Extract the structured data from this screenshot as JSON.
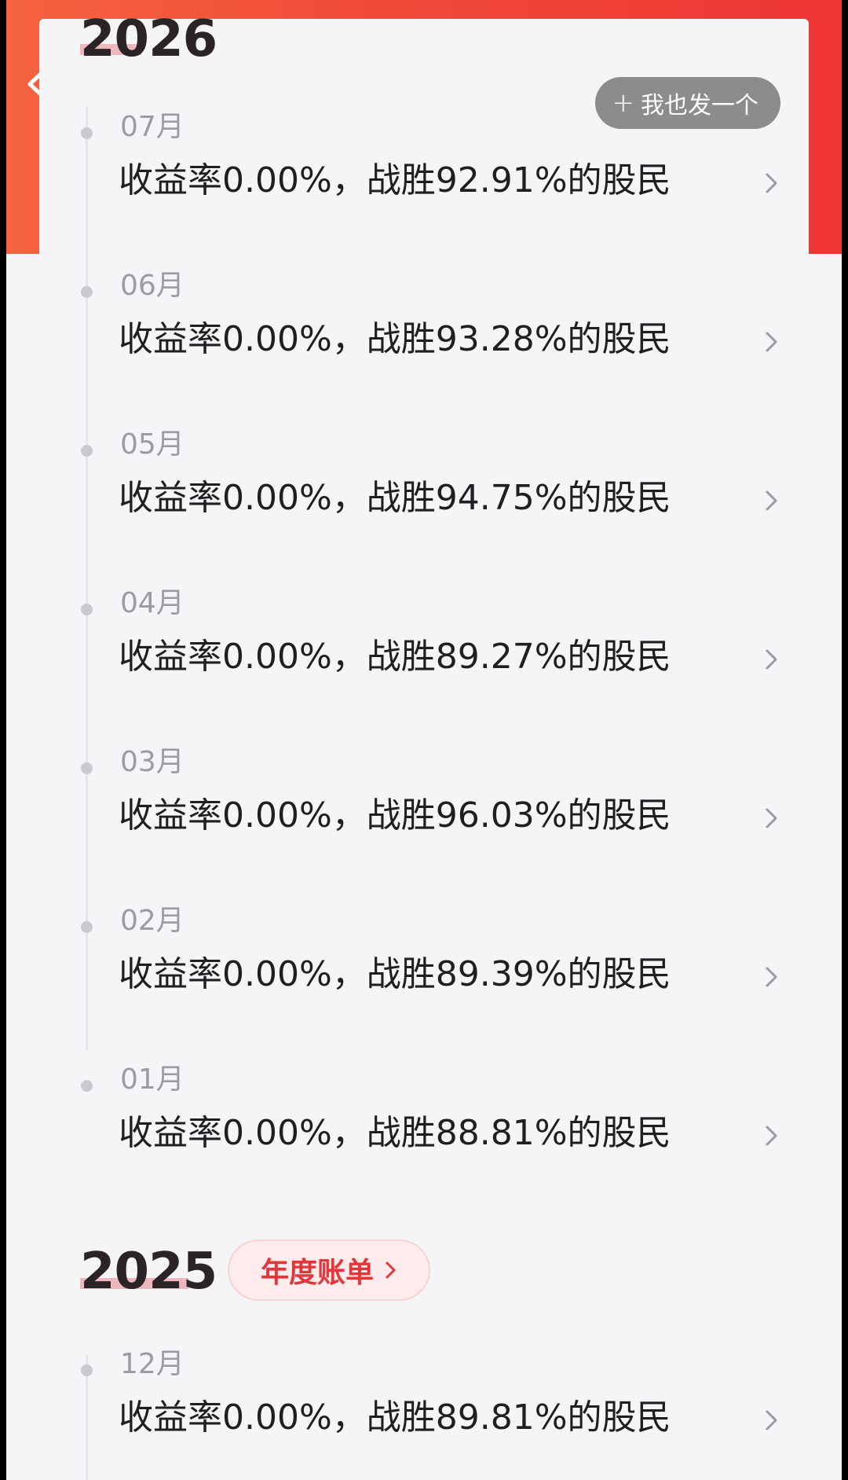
{
  "header": {
    "back_icon": "chevron-left-icon",
    "post_button": {
      "icon": "plus-icon",
      "label": "我也发一个"
    },
    "accent_color": "#ee3a3a"
  },
  "years": [
    {
      "year": "2026",
      "entries": [
        {
          "month": "07月",
          "summary": "收益率0.00%，战胜92.91%的股民"
        },
        {
          "month": "06月",
          "summary": "收益率0.00%，战胜93.28%的股民"
        },
        {
          "month": "05月",
          "summary": "收益率0.00%，战胜94.75%的股民"
        },
        {
          "month": "04月",
          "summary": "收益率0.00%，战胜89.27%的股民"
        },
        {
          "month": "03月",
          "summary": "收益率0.00%，战胜96.03%的股民"
        },
        {
          "month": "02月",
          "summary": "收益率0.00%，战胜89.39%的股民"
        },
        {
          "month": "01月",
          "summary": "收益率0.00%，战胜88.81%的股民"
        }
      ]
    },
    {
      "year": "2025",
      "annual_bill_label": "年度账单",
      "entries": [
        {
          "month": "12月",
          "summary": "收益率0.00%，战胜89.81%的股民"
        }
      ]
    }
  ]
}
